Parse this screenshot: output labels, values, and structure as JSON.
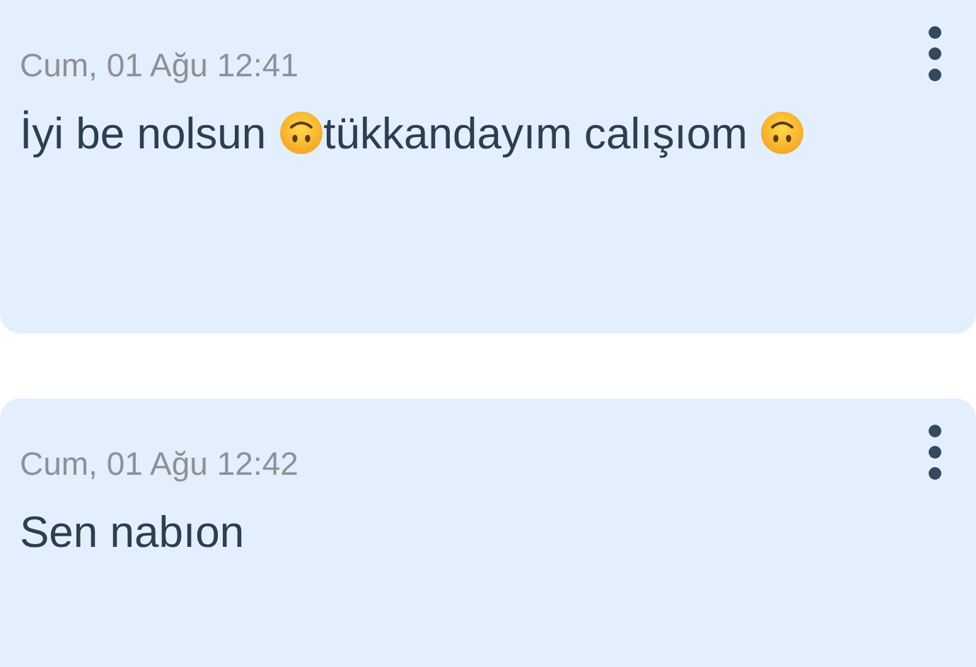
{
  "messages": [
    {
      "timestamp": "Cum, 01 Ağu 12:41",
      "parts": [
        {
          "kind": "text",
          "text": "İyi be nolsun "
        },
        {
          "kind": "emoji"
        },
        {
          "kind": "text",
          "text": "tükkandayım calışıom "
        },
        {
          "kind": "emoji"
        }
      ]
    },
    {
      "timestamp": "Cum, 01 Ağu 12:42",
      "parts": [
        {
          "kind": "text",
          "text": "Sen nabıon"
        }
      ]
    }
  ]
}
